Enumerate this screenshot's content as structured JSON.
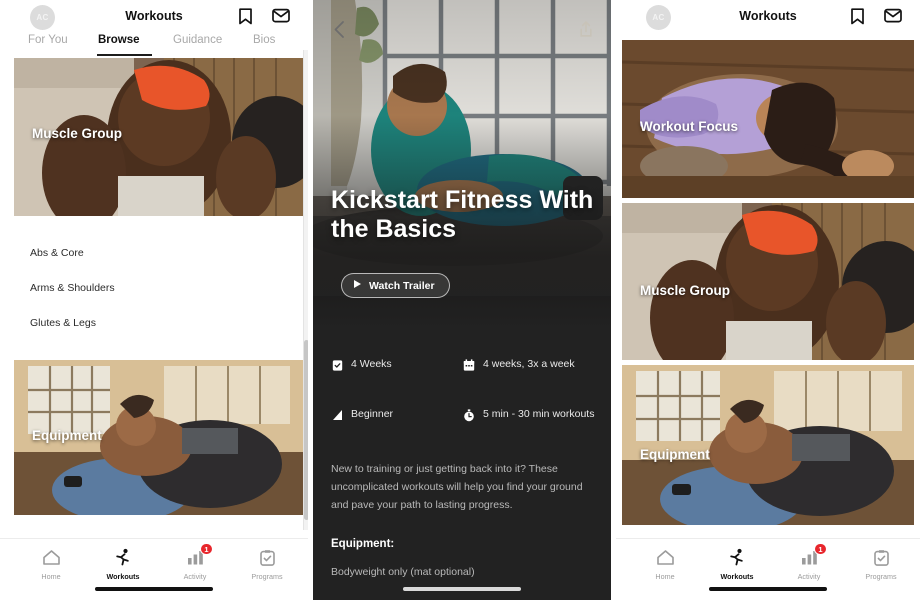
{
  "app": {
    "title": "Workouts",
    "avatar_initials": "AC",
    "icons": {
      "bookmark": "bookmark-icon",
      "mail": "mail-icon"
    }
  },
  "tabs": [
    {
      "label": "For You",
      "active": false
    },
    {
      "label": "Browse",
      "active": true
    },
    {
      "label": "Guidance",
      "active": false
    },
    {
      "label": "Bios",
      "active": false
    }
  ],
  "browse_cards": [
    {
      "label": "Workout Focus"
    },
    {
      "label": "Muscle Group"
    },
    {
      "label": "Equipment"
    }
  ],
  "muscle_group_list": [
    {
      "label": "Abs & Core"
    },
    {
      "label": "Arms & Shoulders"
    },
    {
      "label": "Glutes & Legs"
    }
  ],
  "detail": {
    "back_icon": "chevron-left-icon",
    "share_icon": "share-icon",
    "title": "Kickstart Fitness With the Basics",
    "trailer_button": "Watch Trailer",
    "meta": [
      {
        "icon": "clipboard-icon",
        "value": "4 Weeks"
      },
      {
        "icon": "calendar-icon",
        "value": "4 weeks, 3x a week"
      },
      {
        "icon": "level-bars-icon",
        "value": "Beginner"
      },
      {
        "icon": "stopwatch-icon",
        "value": "5 min - 30 min workouts"
      }
    ],
    "description": "New to training or just getting back into it? These uncomplicated workouts will help you find your ground and pave your path to lasting progress.",
    "equipment_heading": "Equipment:",
    "equipment_value": "Bodyweight only (mat optional)"
  },
  "bottom_nav": [
    {
      "label": "Home",
      "icon": "home-icon",
      "active": false,
      "badge": null
    },
    {
      "label": "Workouts",
      "icon": "runner-icon",
      "active": true,
      "badge": null
    },
    {
      "label": "Activity",
      "icon": "bar-chart-icon",
      "active": false,
      "badge": "1"
    },
    {
      "label": "Programs",
      "icon": "clipboard-check-icon",
      "active": false,
      "badge": null
    }
  ],
  "colors": {
    "accent_badge": "#e8262c",
    "dark_panel": "#222222",
    "text_primary": "#111111",
    "text_muted": "#a8a8a8"
  }
}
